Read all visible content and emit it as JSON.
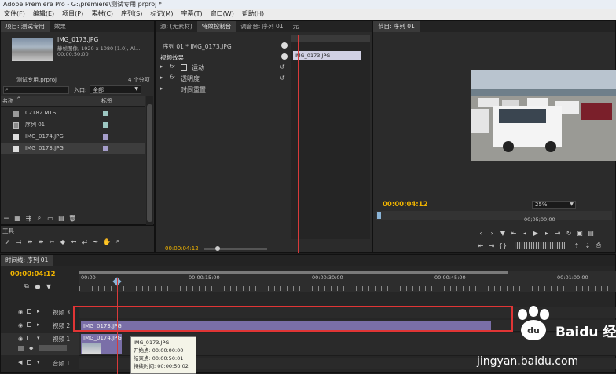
{
  "app": {
    "title": "Adobe Premiere Pro - G:\\premiere\\测试专用.prproj *"
  },
  "menu": [
    "文件(F)",
    "编辑(E)",
    "项目(P)",
    "素材(C)",
    "序列(S)",
    "标记(M)",
    "字幕(T)",
    "窗口(W)",
    "帮助(H)"
  ],
  "project": {
    "tabs": [
      "项目: 测试专用",
      "效果"
    ],
    "preview": {
      "name": "IMG_0173.JPG",
      "type": "静帧图像, 1920 x 1080 (1.0), Al...",
      "duration": "00;00;50;00"
    },
    "file": "测试专用.prproj",
    "count": "4 个分项",
    "in_label": "入口:",
    "in_value": "全部",
    "col_name": "名称",
    "col_label": "标签",
    "items": [
      {
        "name": "02182.MTS",
        "color": "#9dc7c2"
      },
      {
        "name": "序列 01",
        "color": "#9dc7c2"
      },
      {
        "name": "IMG_0174.JPG",
        "color": "#a59ecb"
      },
      {
        "name": "IMG_0173.JPG",
        "color": "#a59ecb"
      }
    ]
  },
  "effects_panel": {
    "tabs": [
      "源: (无素材)",
      "特效控制台",
      "调音台: 序列 01",
      "元"
    ],
    "header": "序列 01 * IMG_0173.JPG",
    "clip": "IMG_0173.JPG",
    "section": "视频效果",
    "items": [
      "运动",
      "透明度",
      "时间重置"
    ],
    "timecode": "00:00:04:12"
  },
  "program": {
    "tab": "节目: 序列 01",
    "timecode": "00:00:04:12",
    "zoom": "25%",
    "ruler_mid": "00;05;00;00"
  },
  "tools": {
    "title": "工具"
  },
  "timeline": {
    "tab": "时间线: 序列 01",
    "timecode": "00:00:04:12",
    "ruler": [
      "00:00",
      "00:00:15:00",
      "00:00:30:00",
      "00:00:45:00",
      "00:01:00:00"
    ],
    "tracks": [
      "视频 3",
      "视频 2",
      "视频 1",
      "音频 1"
    ],
    "clips": {
      "v2": "IMG_0173.JPG",
      "v1": "IMG_0174.JPG"
    },
    "tooltip": {
      "name": "IMG_0173.JPG",
      "start": "开始点: 00:00:00:00",
      "end": "结束点: 00:00:50:01",
      "duration": "持续时间: 00:00:50:02"
    }
  },
  "watermark": {
    "brand": "Baidu 经验",
    "url": "jingyan.baidu.com"
  },
  "colors": {
    "accent": "#f0b400",
    "playhead": "#d83a3a",
    "highlight": "#e03535"
  }
}
